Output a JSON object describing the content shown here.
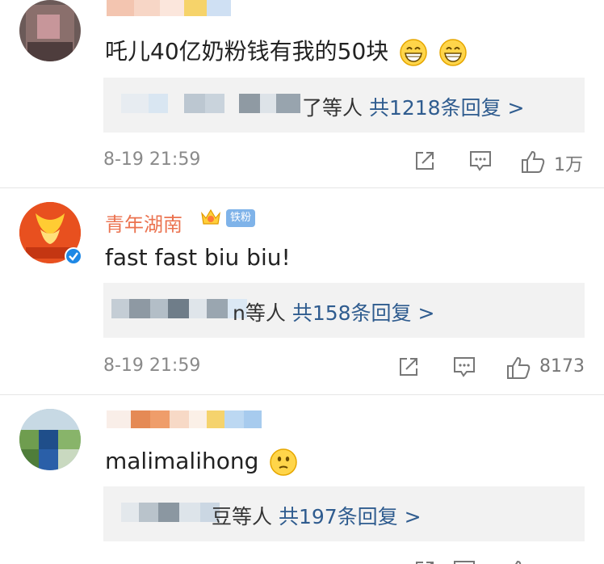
{
  "comments": [
    {
      "text": "吒儿40亿奶粉钱有我的50块",
      "reply": {
        "suffix": "了等人",
        "count": "共1218条回复 >"
      },
      "time": "8-19 21:59",
      "likes": "1万"
    },
    {
      "username": "青年湖南",
      "badge": "铁粉",
      "text": "fast fast biu biu!",
      "reply": {
        "suffix": "n等人",
        "count": "共158条回复 >"
      },
      "time": "8-19 21:59",
      "likes": "8173"
    },
    {
      "text": "malimalihong",
      "reply": {
        "suffix": "豆等人",
        "count": "共197条回复 >"
      }
    }
  ],
  "icons": {
    "share": "share-icon",
    "comment": "comment-icon",
    "like": "thumbs-up-icon",
    "grin": "grin-emoji-icon",
    "think": "thinking-emoji-icon",
    "crown": "crown-badge-icon",
    "verified": "verified-icon"
  },
  "colors": {
    "username": "#eb7350",
    "reply_link": "#2f5c8f",
    "reply_bg": "#f2f2f2",
    "meta": "#8a8a8a",
    "verified": "#1e88e5",
    "fan_badge": "#7fb3e9"
  }
}
